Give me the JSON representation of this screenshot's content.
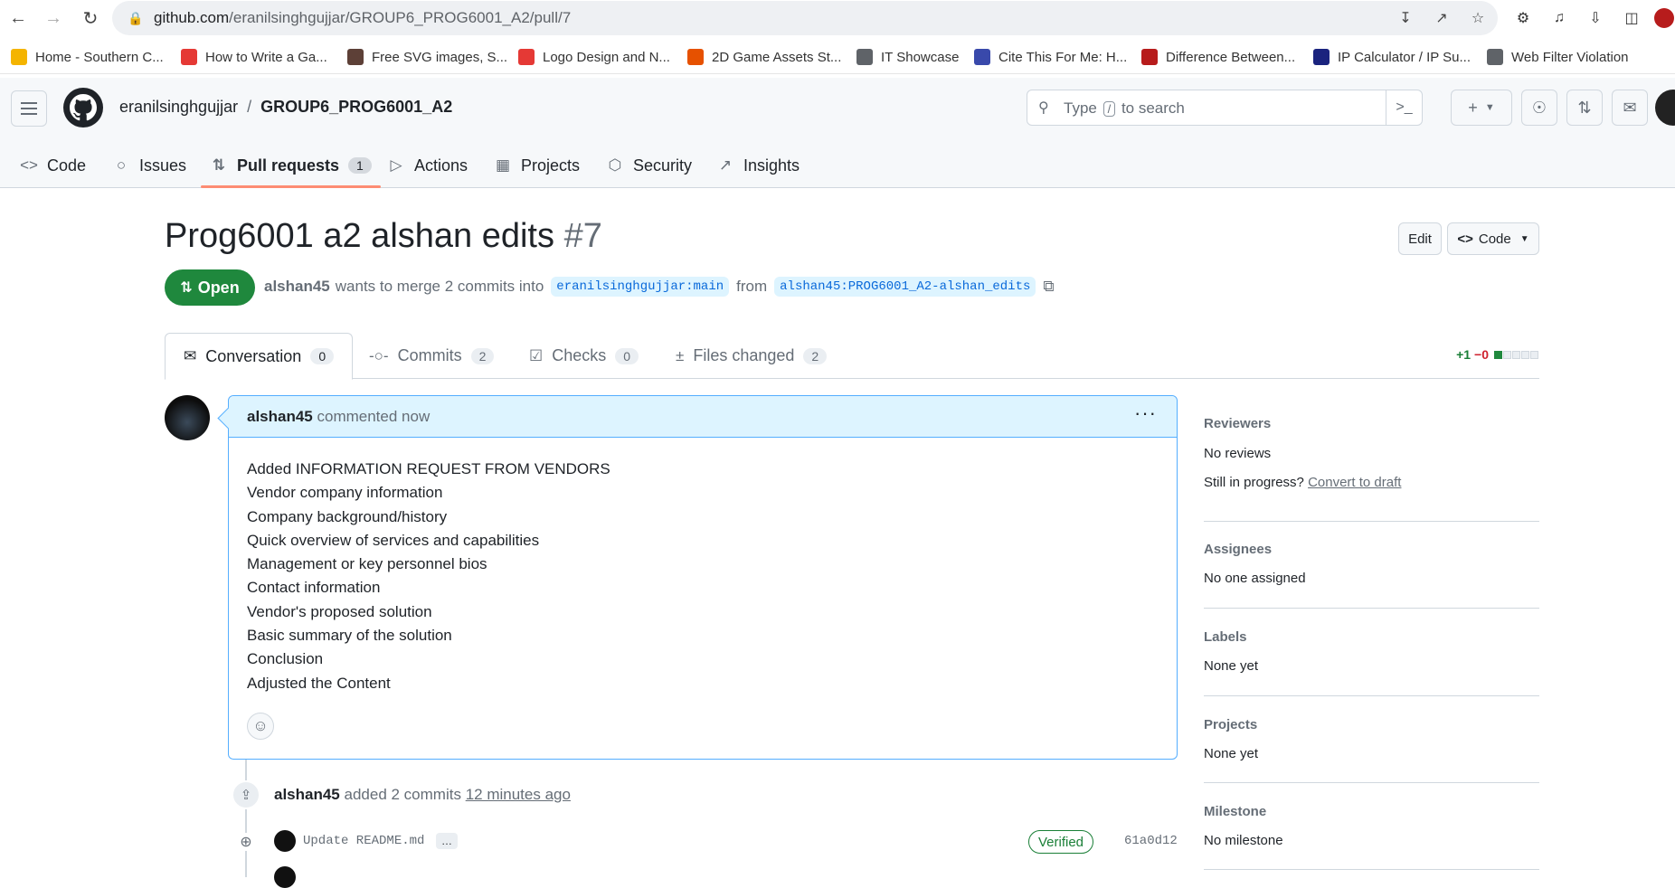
{
  "browser": {
    "url_host": "github.com",
    "url_path": "/eranilsinghgujjar/GROUP6_PROG6001_A2/pull/7"
  },
  "bookmarks": [
    {
      "label": "Home - Southern C...",
      "icon": "shield-bookmark-icon",
      "color": "#f4b400"
    },
    {
      "label": "How to Write a Ga...",
      "icon": "red-circle-bookmark-icon",
      "color": "#e53935"
    },
    {
      "label": "Free SVG images, S...",
      "icon": "svg-bookmark-icon",
      "color": "#5d4037"
    },
    {
      "label": "Logo Design and N...",
      "icon": "flame-bookmark-icon",
      "color": "#e53935"
    },
    {
      "label": "2D Game Assets St...",
      "icon": "game-bookmark-icon",
      "color": "#e65100"
    },
    {
      "label": "IT Showcase",
      "icon": "globe-bookmark-icon",
      "color": "#5f6368"
    },
    {
      "label": "Cite This For Me: H...",
      "icon": "book-bookmark-icon",
      "color": "#3949ab"
    },
    {
      "label": "Difference Between...",
      "icon": "td-bookmark-icon",
      "color": "#b71c1c"
    },
    {
      "label": "IP Calculator / IP Su...",
      "icon": "ip-bookmark-icon",
      "color": "#1a237e"
    },
    {
      "label": "Web Filter Violation",
      "icon": "globe-bookmark-icon",
      "color": "#5f6368"
    }
  ],
  "header": {
    "owner": "eranilsinghgujjar",
    "separator": "/",
    "repo": "GROUP6_PROG6001_A2",
    "search_prefix": "Type",
    "search_key": "/",
    "search_suffix": "to search"
  },
  "repo_tabs": [
    {
      "label": "Code",
      "icon": "code-icon"
    },
    {
      "label": "Issues",
      "icon": "issue-icon"
    },
    {
      "label": "Pull requests",
      "icon": "pull-request-icon",
      "count": "1",
      "active": true
    },
    {
      "label": "Actions",
      "icon": "play-icon"
    },
    {
      "label": "Projects",
      "icon": "table-icon"
    },
    {
      "label": "Security",
      "icon": "shield-icon"
    },
    {
      "label": "Insights",
      "icon": "graph-icon"
    }
  ],
  "pr": {
    "title": "Prog6001 a2 alshan edits",
    "number": "#7",
    "edit_label": "Edit",
    "code_label": "Code",
    "state": "Open",
    "author": "alshan45",
    "merge_text": "wants to merge 2 commits into",
    "base_branch": "eranilsinghgujjar:main",
    "from_text": "from",
    "head_branch": "alshan45:PROG6001_A2-alshan_edits"
  },
  "pr_tabs": [
    {
      "label": "Conversation",
      "count": "0",
      "active": true
    },
    {
      "label": "Commits",
      "count": "2"
    },
    {
      "label": "Checks",
      "count": "0"
    },
    {
      "label": "Files changed",
      "count": "2"
    }
  ],
  "diffstat": {
    "additions": "+1",
    "deletions": "−0"
  },
  "comment": {
    "author": "alshan45",
    "meta": "commented now",
    "lines": [
      "Added INFORMATION REQUEST FROM VENDORS",
      "Vendor company information",
      "Company background/history",
      "Quick overview of services and capabilities",
      "Management or key personnel bios",
      "Contact information",
      "Vendor's proposed solution",
      "Basic summary of the solution",
      "Conclusion",
      "Adjusted the Content"
    ]
  },
  "timeline": {
    "author": "alshan45",
    "action": "added 2 commits",
    "time": "12 minutes ago",
    "commit_message": "Update README.md",
    "commit_more": "…",
    "verified": "Verified",
    "sha": "61a0d12"
  },
  "sidebar": {
    "reviewers_title": "Reviewers",
    "reviewers_value": "No reviews",
    "draft_prompt": "Still in progress?",
    "draft_link": "Convert to draft",
    "assignees_title": "Assignees",
    "assignees_value": "No one assigned",
    "labels_title": "Labels",
    "labels_value": "None yet",
    "projects_title": "Projects",
    "projects_value": "None yet",
    "milestone_title": "Milestone",
    "milestone_value": "No milestone"
  },
  "colors": {
    "open_green": "#1f883d",
    "link_blue": "#0969da",
    "active_tab_underline": "#fd8c73",
    "comment_header_bg": "#ddf4ff"
  }
}
